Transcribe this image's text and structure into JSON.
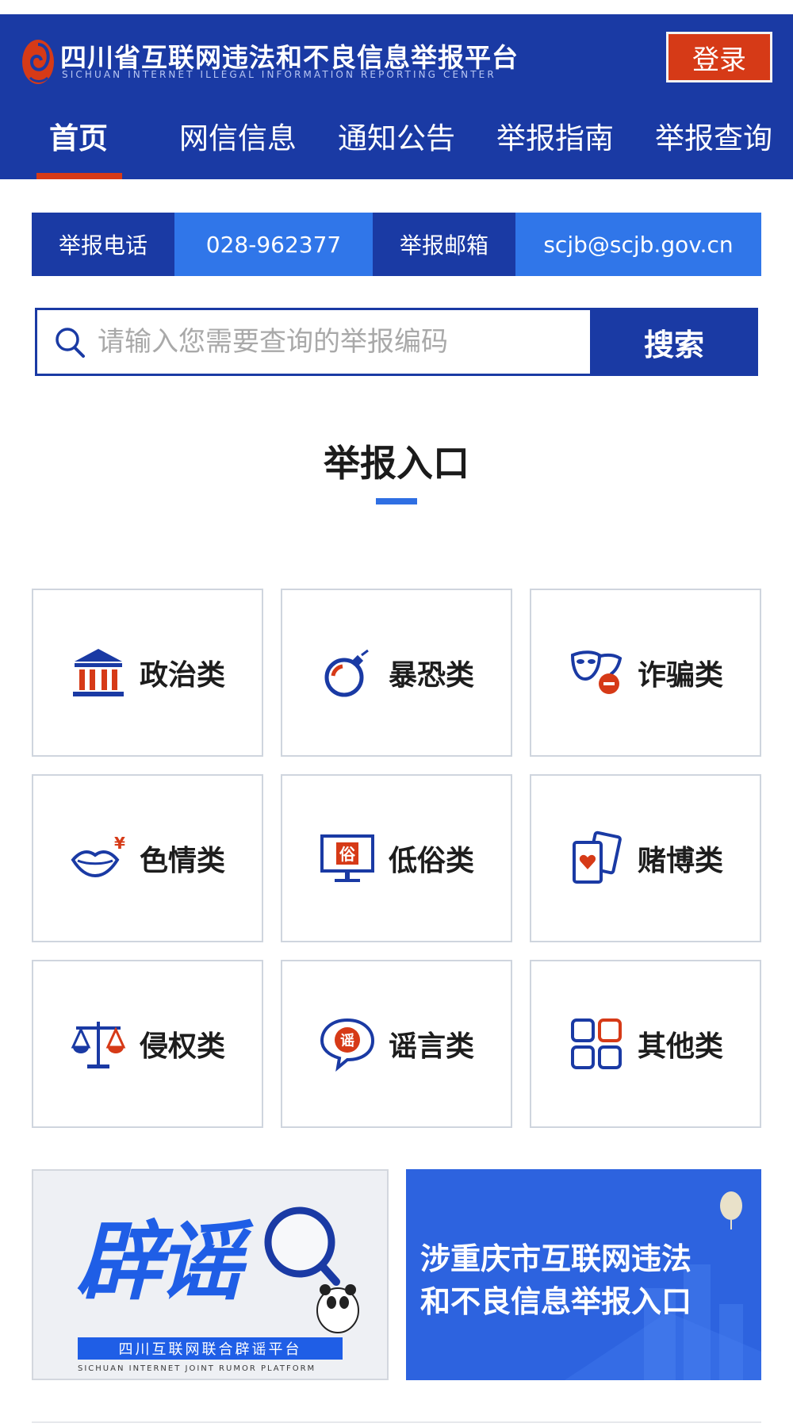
{
  "header": {
    "title": "四川省互联网违法和不良信息举报平台",
    "subtitle": "SICHUAN INTERNET ILLEGAL INFORMATION REPORTING CENTER",
    "login_label": "登录"
  },
  "nav": {
    "items": [
      {
        "label": "首页",
        "active": true
      },
      {
        "label": "网信信息"
      },
      {
        "label": "通知公告"
      },
      {
        "label": "举报指南"
      },
      {
        "label": "举报查询"
      }
    ]
  },
  "contact": {
    "phone_label": "举报电话",
    "phone_value": "028-962377",
    "email_label": "举报邮箱",
    "email_value": "scjb@scjb.gov.cn"
  },
  "search": {
    "placeholder": "请输入您需要查询的举报编码",
    "button_label": "搜索"
  },
  "section": {
    "title": "举报入口"
  },
  "categories": [
    {
      "label": "政治类",
      "icon": "government-building-icon"
    },
    {
      "label": "暴恐类",
      "icon": "bomb-icon"
    },
    {
      "label": "诈骗类",
      "icon": "mask-icon"
    },
    {
      "label": "色情类",
      "icon": "lips-icon"
    },
    {
      "label": "低俗类",
      "icon": "monitor-icon"
    },
    {
      "label": "赌博类",
      "icon": "playing-cards-icon"
    },
    {
      "label": "侵权类",
      "icon": "scales-icon"
    },
    {
      "label": "谣言类",
      "icon": "speech-bubble-icon"
    },
    {
      "label": "其他类",
      "icon": "grid-icon"
    }
  ],
  "icon_glyphs": {
    "su": "俗",
    "yao": "谣"
  },
  "banners": {
    "left": {
      "big_text": "辟谣",
      "strip_text": "四川互联网联合辟谣平台",
      "sub_text": "SICHUAN INTERNET JOINT RUMOR PLATFORM"
    },
    "right": {
      "line1": "涉重庆市互联网违法",
      "line2": "和不良信息举报入口"
    }
  },
  "colors": {
    "brand_blue": "#1a3aa4",
    "accent_blue": "#3076e9",
    "accent_red": "#d63a17"
  }
}
